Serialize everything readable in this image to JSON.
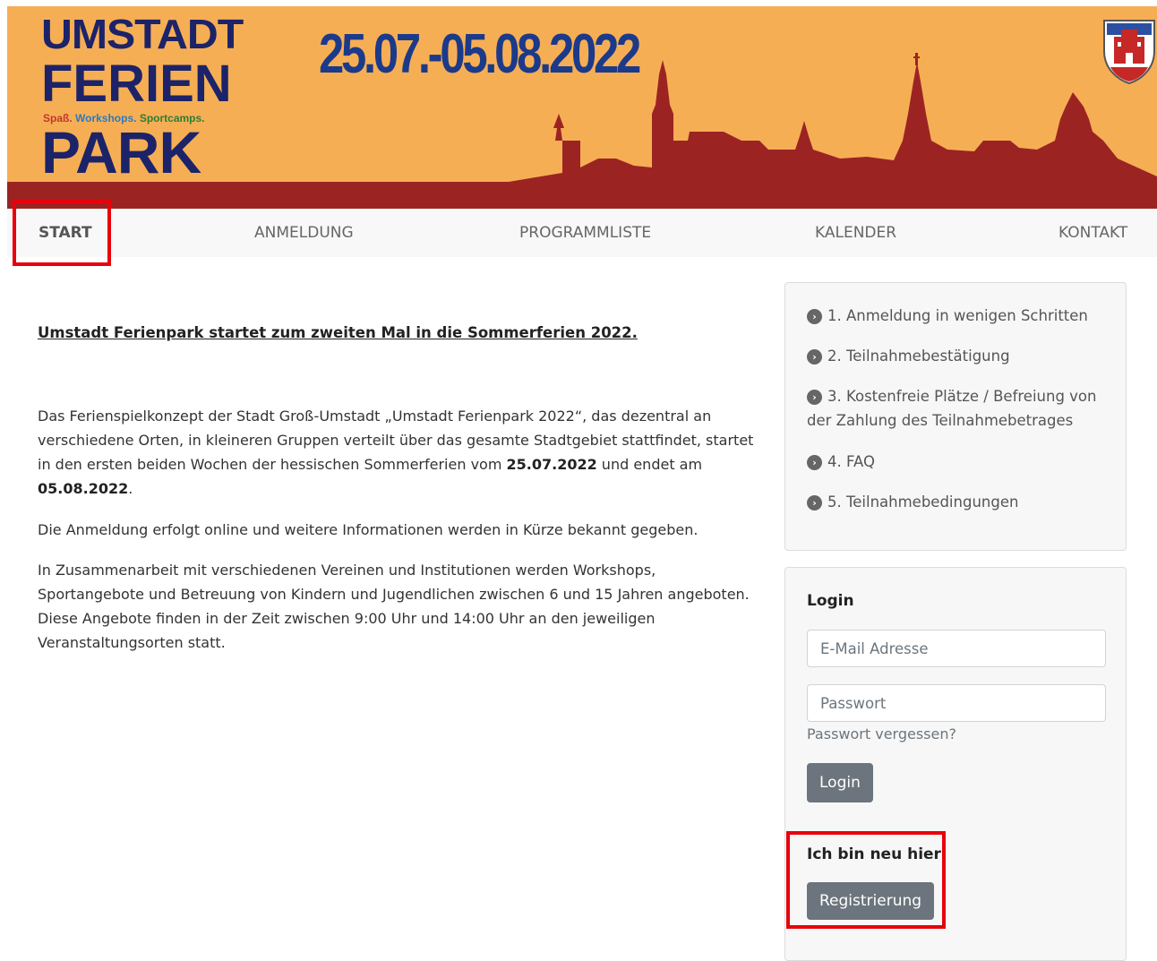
{
  "banner": {
    "logo_line1": "UMSTADT",
    "logo_line2": "FERIEN",
    "logo_tag_a": "Spaß.",
    "logo_tag_b": "Workshops.",
    "logo_tag_c": "Sportcamps.",
    "logo_line3": "PARK",
    "dates": "25.07.-05.08.2022",
    "colors": {
      "background": "#f6ae55",
      "skyline": "#9b2423",
      "logo": "#1c2368",
      "dates": "#1c3a8a"
    }
  },
  "nav": {
    "items": [
      {
        "label": "START",
        "active": true
      },
      {
        "label": "ANMELDUNG",
        "active": false
      },
      {
        "label": "PROGRAMMLISTE",
        "active": false
      },
      {
        "label": "KALENDER",
        "active": false
      },
      {
        "label": "KONTAKT",
        "active": false
      }
    ]
  },
  "main": {
    "headline": "Umstadt Ferienpark startet zum zweiten Mal in die Sommerferien 2022.",
    "p1_text1": "Das Ferienspielkonzept der Stadt Groß-Umstadt „Umstadt Ferienpark 2022“, das dezentral an verschiedene Orten, in kleineren Gruppen verteilt über das gesamte Stadtgebiet stattfindet, startet in den ersten beiden Wochen der hessischen Sommerferien vom ",
    "p1_date_start": "25.07.2022",
    "p1_text2": " und endet am ",
    "p1_date_end": "05.08.2022",
    "p1_text3": ".",
    "p2": "Die Anmeldung erfolgt online und weitere Informationen werden in Kürze bekannt gegeben.",
    "p3": "In Zusammenarbeit mit verschiedenen Vereinen und Institutionen werden Workshops, Sportangebote und Betreuung von Kindern und Jugendlichen zwischen 6 und 15 Jahren angeboten. Diese Angebote finden in der Zeit zwischen 9:00 Uhr und 14:00 Uhr an den jeweiligen Veranstaltungsorten statt."
  },
  "sidebar": {
    "links": [
      "1. Anmeldung in wenigen Schritten",
      "2. Teilnahmebestätigung",
      "3. Kostenfreie Plätze / Befreiung von der Zahlung des Teilnahmebetrages",
      "4. FAQ",
      "5. Teilnahmebedingungen"
    ],
    "login": {
      "title": "Login",
      "email_placeholder": "E-Mail Adresse",
      "password_placeholder": "Passwort",
      "forgot": "Passwort vergessen?",
      "button": "Login"
    },
    "register": {
      "title": "Ich bin neu hier",
      "button": "Registrierung"
    }
  },
  "highlight_color": "#e8000b"
}
